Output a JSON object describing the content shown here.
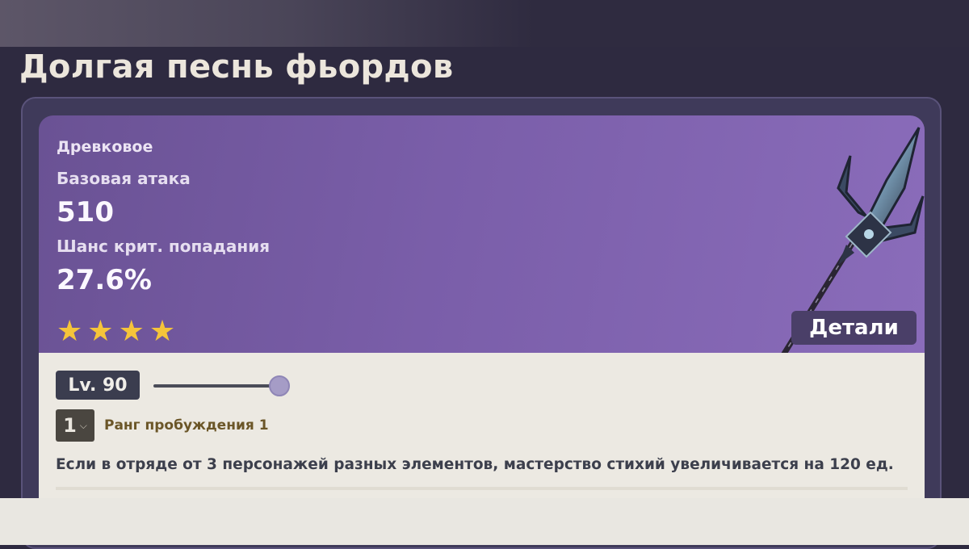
{
  "page": {
    "title": "Долгая песнь фьордов"
  },
  "weapon": {
    "type": "Древковое",
    "base_atk_label": "Базовая атака",
    "base_atk_value": "510",
    "crit_rate_label": "Шанс крит. попадания",
    "crit_rate_value": "27.6%",
    "rarity_stars": 4,
    "star_glyph": "★",
    "details_label": "Детали",
    "image_icon": "polearm-weapon-icon"
  },
  "level": {
    "label": "Lv. 90",
    "slider_fraction": 1.0
  },
  "refinement": {
    "value": "1",
    "label": "Ранг пробуждения 1"
  },
  "passive": {
    "text": "Если в отряде от 3 персонажей разных элементов, мастерство стихий увеличивается на 120 ед."
  },
  "colors": {
    "card_purple": "#7a5ea9",
    "star_gold": "#f5c43a",
    "details_bg": "#4a3f68",
    "refine_label": "#6b5628"
  }
}
